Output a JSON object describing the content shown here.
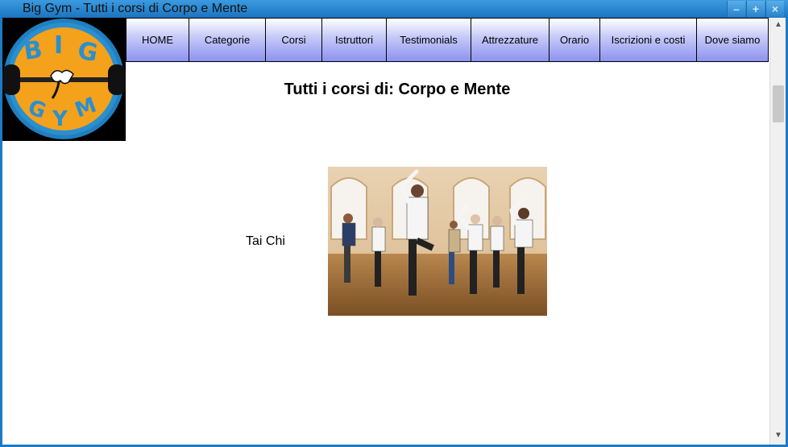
{
  "window": {
    "title": "Big Gym - Tutti i corsi di Corpo e Mente",
    "buttons": [
      "minimize-icon",
      "maximize-icon",
      "close-icon"
    ]
  },
  "logo": {
    "top_text": "BIG",
    "bottom_text": "GYM",
    "colors": {
      "ring": "#1f7fbf",
      "fill": "#f4a11c",
      "bg": "#000000"
    }
  },
  "nav": {
    "items": [
      "HOME",
      "Categorie",
      "Corsi",
      "Istruttori",
      "Testimonials",
      "Attrezzature",
      "Orario",
      "Iscrizioni e costi",
      "Dove siamo"
    ]
  },
  "main": {
    "title": "Tutti i corsi di: Corpo e Mente",
    "courses": [
      {
        "name": "Tai Chi"
      }
    ]
  }
}
